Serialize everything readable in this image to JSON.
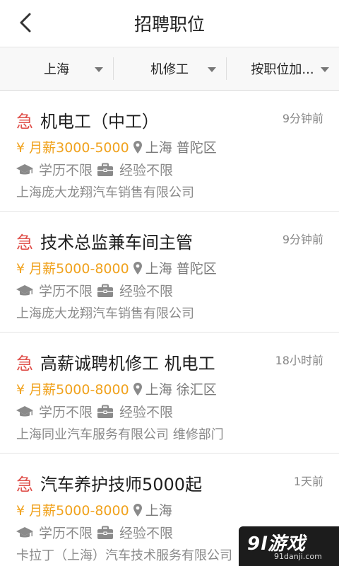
{
  "header": {
    "title": "招聘职位"
  },
  "filters": [
    {
      "label": "上海"
    },
    {
      "label": "机修工"
    },
    {
      "label": "按职位加..."
    }
  ],
  "jobs": [
    {
      "urgent": "急",
      "title": "机电工（中工）",
      "time": "9分钟前",
      "salary": "¥ 月薪3000-5000",
      "location": "上海 普陀区",
      "education": "学历不限",
      "experience": "经验不限",
      "company": "上海庞大龙翔汽车销售有限公司"
    },
    {
      "urgent": "急",
      "title": "技术总监兼车间主管",
      "time": "9分钟前",
      "salary": "¥ 月薪5000-8000",
      "location": "上海 普陀区",
      "education": "学历不限",
      "experience": "经验不限",
      "company": "上海庞大龙翔汽车销售有限公司"
    },
    {
      "urgent": "急",
      "title": "高薪诚聘机修工 机电工",
      "time": "18小时前",
      "salary": "¥ 月薪5000-8000",
      "location": "上海 徐汇区",
      "education": "学历不限",
      "experience": "经验不限",
      "company": "上海同业汽车服务有限公司 维修部门"
    },
    {
      "urgent": "急",
      "title": "汽车养护技师5000起",
      "time": "1天前",
      "salary": "¥ 月薪5000-8000",
      "location": "上海",
      "education": "学历不限",
      "experience": "经验不限",
      "company": "卡拉丁（上海）汽车技术服务有限公司"
    }
  ],
  "watermark": {
    "main": "9l游戏",
    "sub": "91danji.com"
  },
  "icons": {
    "back": "chevron-left-icon",
    "location": "map-pin-icon",
    "education": "graduation-cap-icon",
    "experience": "briefcase-icon",
    "dropdown": "caret-down-icon"
  },
  "colors": {
    "urgent": "#e0534e",
    "salary": "#f0a21d"
  }
}
